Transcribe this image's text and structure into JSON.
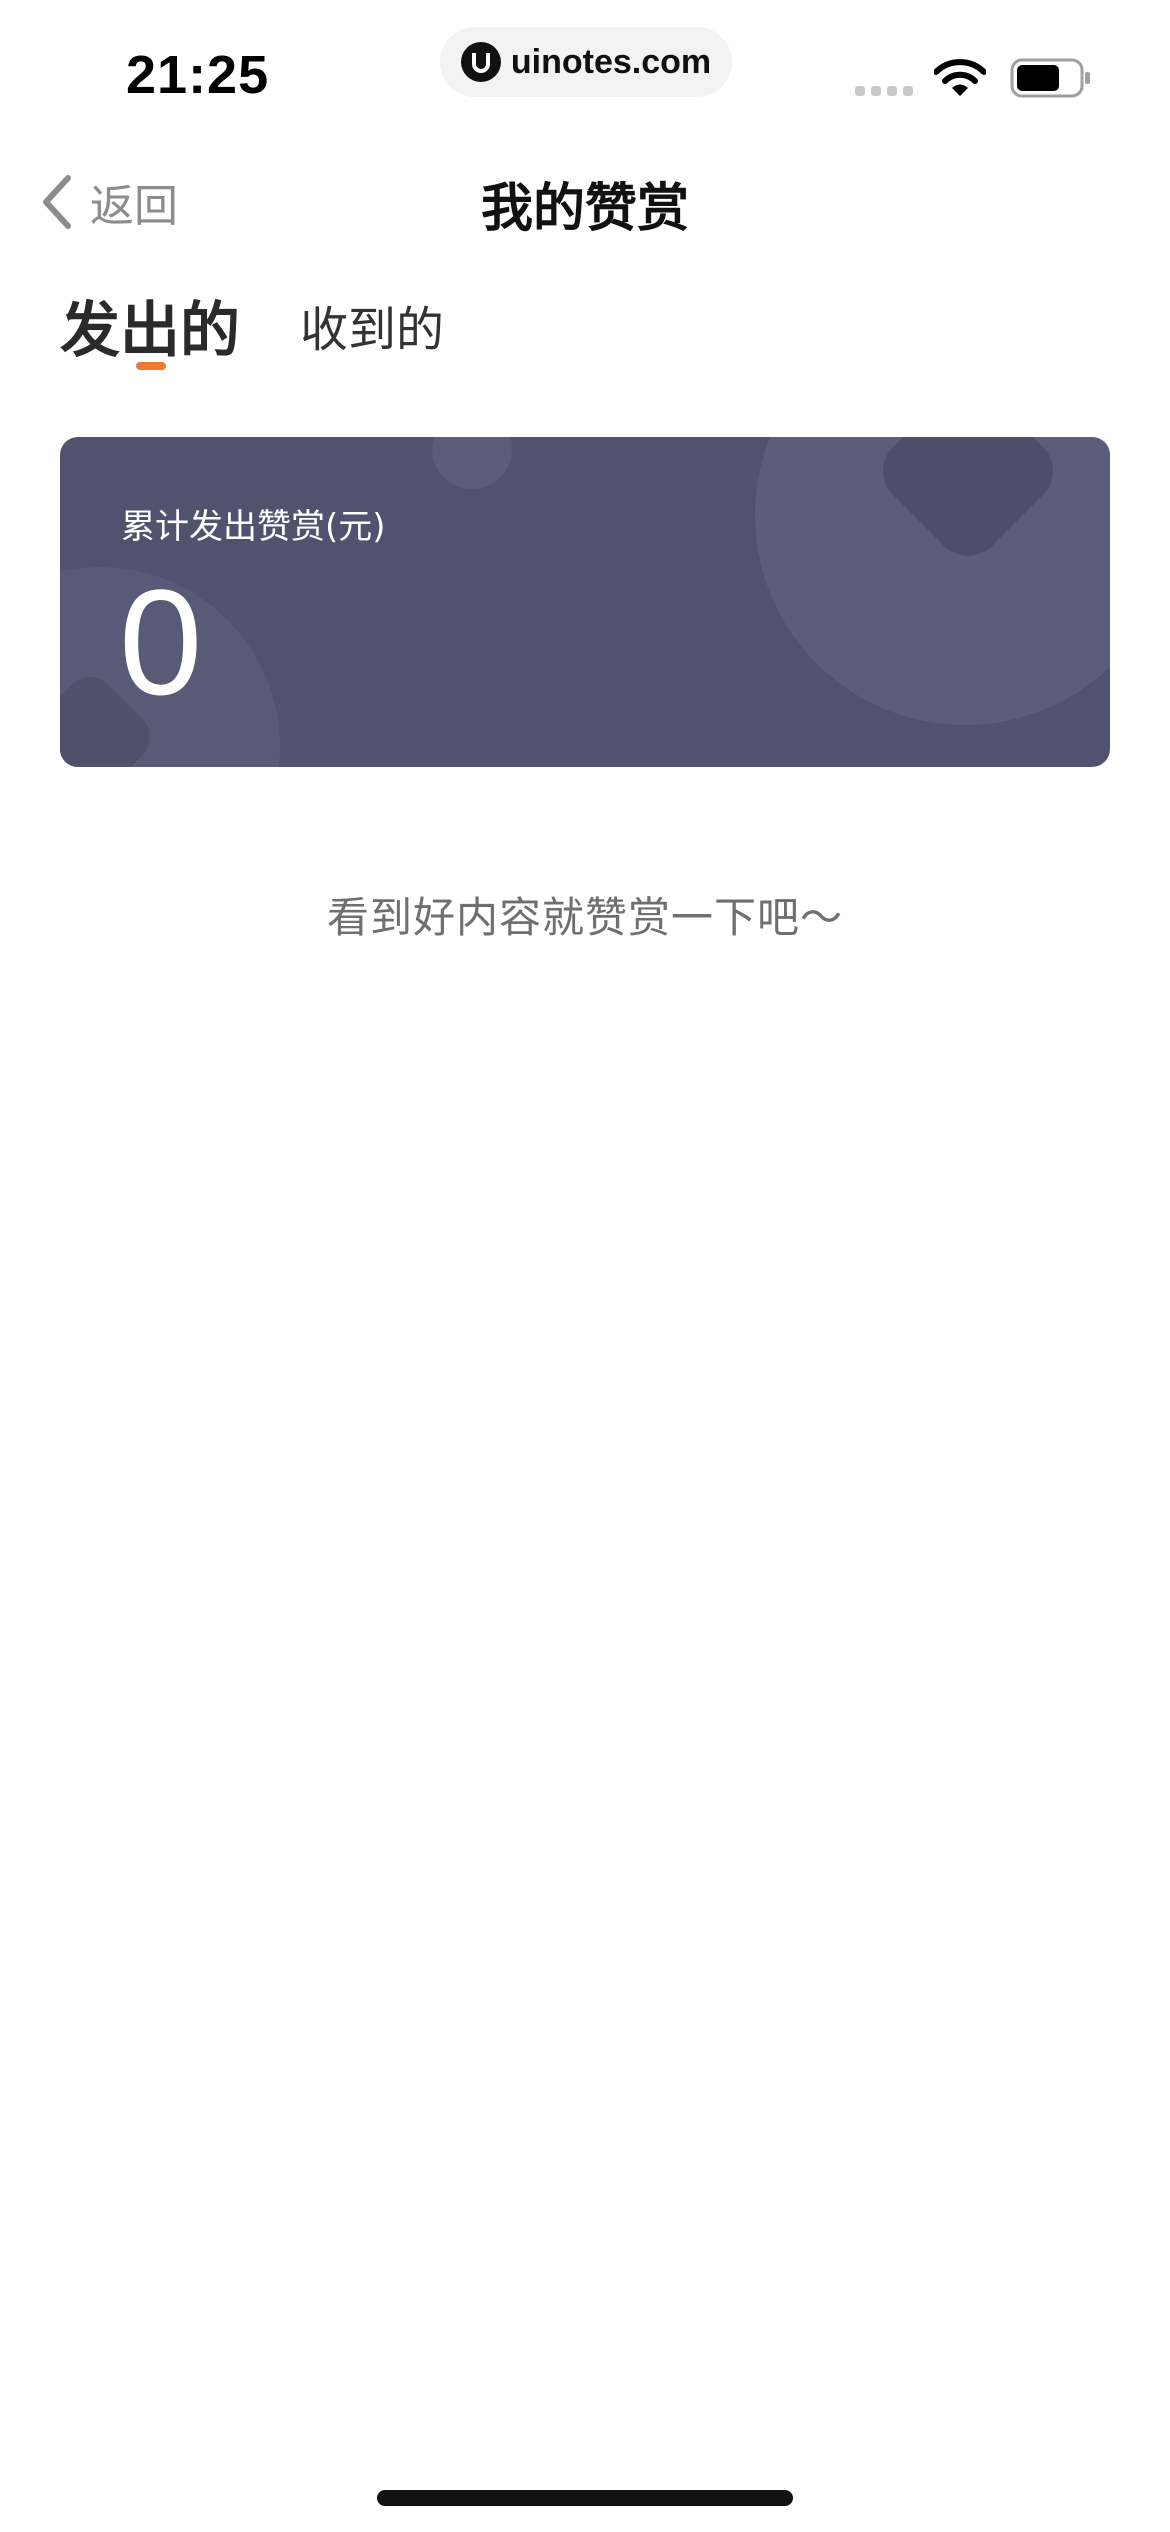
{
  "status_bar": {
    "time": "21:25",
    "url": "uinotes.com",
    "icons": [
      "cellular-signal-icon",
      "wifi-icon",
      "battery-icon"
    ]
  },
  "nav": {
    "back_label": "返回",
    "title": "我的赞赏"
  },
  "tabs": [
    {
      "label": "发出的",
      "active": true
    },
    {
      "label": "收到的",
      "active": false
    }
  ],
  "summary": {
    "label": "累计发出赞赏(元)",
    "value": "0"
  },
  "empty_hint": "看到好内容就赞赏一下吧～",
  "colors": {
    "accent": "#f07a34",
    "card_bg": "#50526e",
    "title_text": "#111111",
    "secondary_text": "#8c8c8c"
  }
}
